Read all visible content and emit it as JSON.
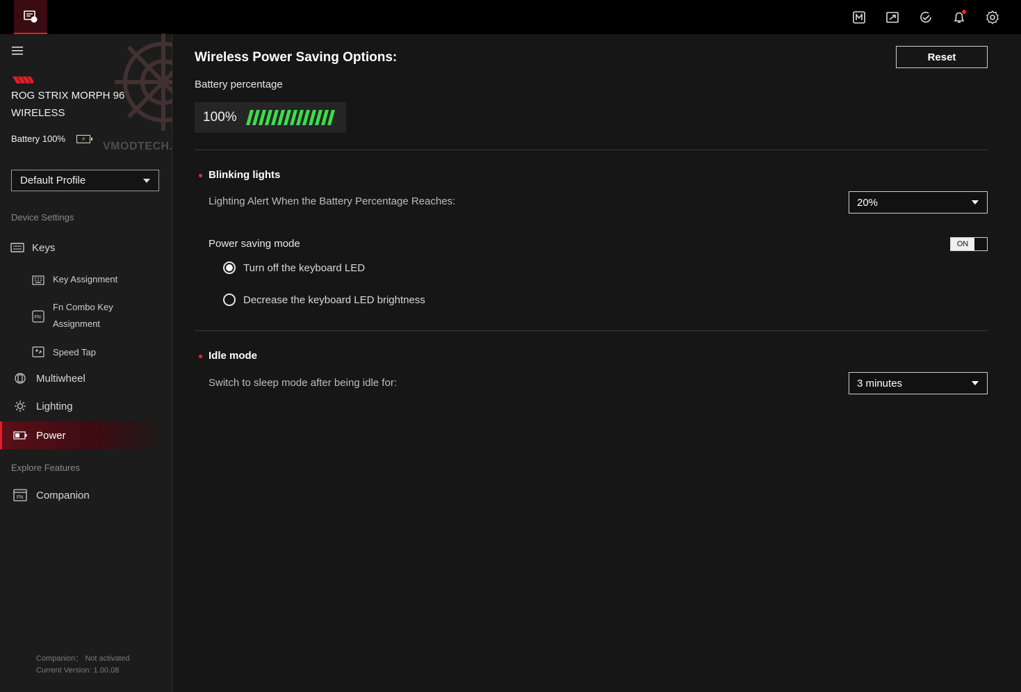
{
  "app": {
    "tab_icon": "device-icon"
  },
  "topbar": {
    "icons": [
      "macro-icon",
      "scenario-icon",
      "update-icon",
      "notification-icon",
      "settings-icon"
    ]
  },
  "sidebar": {
    "device_name_line1": "ROG STRIX MORPH 96",
    "device_name_line2": "WIRELESS",
    "battery_label": "Battery 100%",
    "profile": "Default Profile",
    "section_device": "Device Settings",
    "keys": "Keys",
    "key_assignment": "Key Assignment",
    "fn_combo_line1": "Fn Combo Key",
    "fn_combo_line2": "Assignment",
    "speed_tap": "Speed Tap",
    "multiwheel": "Multiwheel",
    "lighting": "Lighting",
    "power": "Power",
    "section_explore": "Explore Features",
    "companion": "Companion",
    "footer_companion": "Companion： Not activated",
    "footer_version": "Current Version: 1.00.08"
  },
  "watermark": {
    "text": "VMODTECH.COM"
  },
  "main": {
    "title": "Wireless Power Saving Options:",
    "reset": "Reset",
    "battery_label": "Battery percentage",
    "battery_value": "100%",
    "battery_level": 1.0,
    "blinking": {
      "title": "Blinking lights",
      "alert_label": "Lighting Alert When the Battery Percentage Reaches:",
      "alert_value": "20%"
    },
    "power_saving": {
      "label": "Power saving mode",
      "toggle": "ON",
      "option1": "Turn off the keyboard LED",
      "option2": "Decrease the keyboard LED brightness",
      "selected": 1
    },
    "idle": {
      "title": "Idle mode",
      "label": "Switch to sleep mode after being idle for:",
      "value": "3 minutes"
    }
  },
  "colors": {
    "accent": "#e51d2a",
    "battery_green": "#3ddc4a"
  }
}
